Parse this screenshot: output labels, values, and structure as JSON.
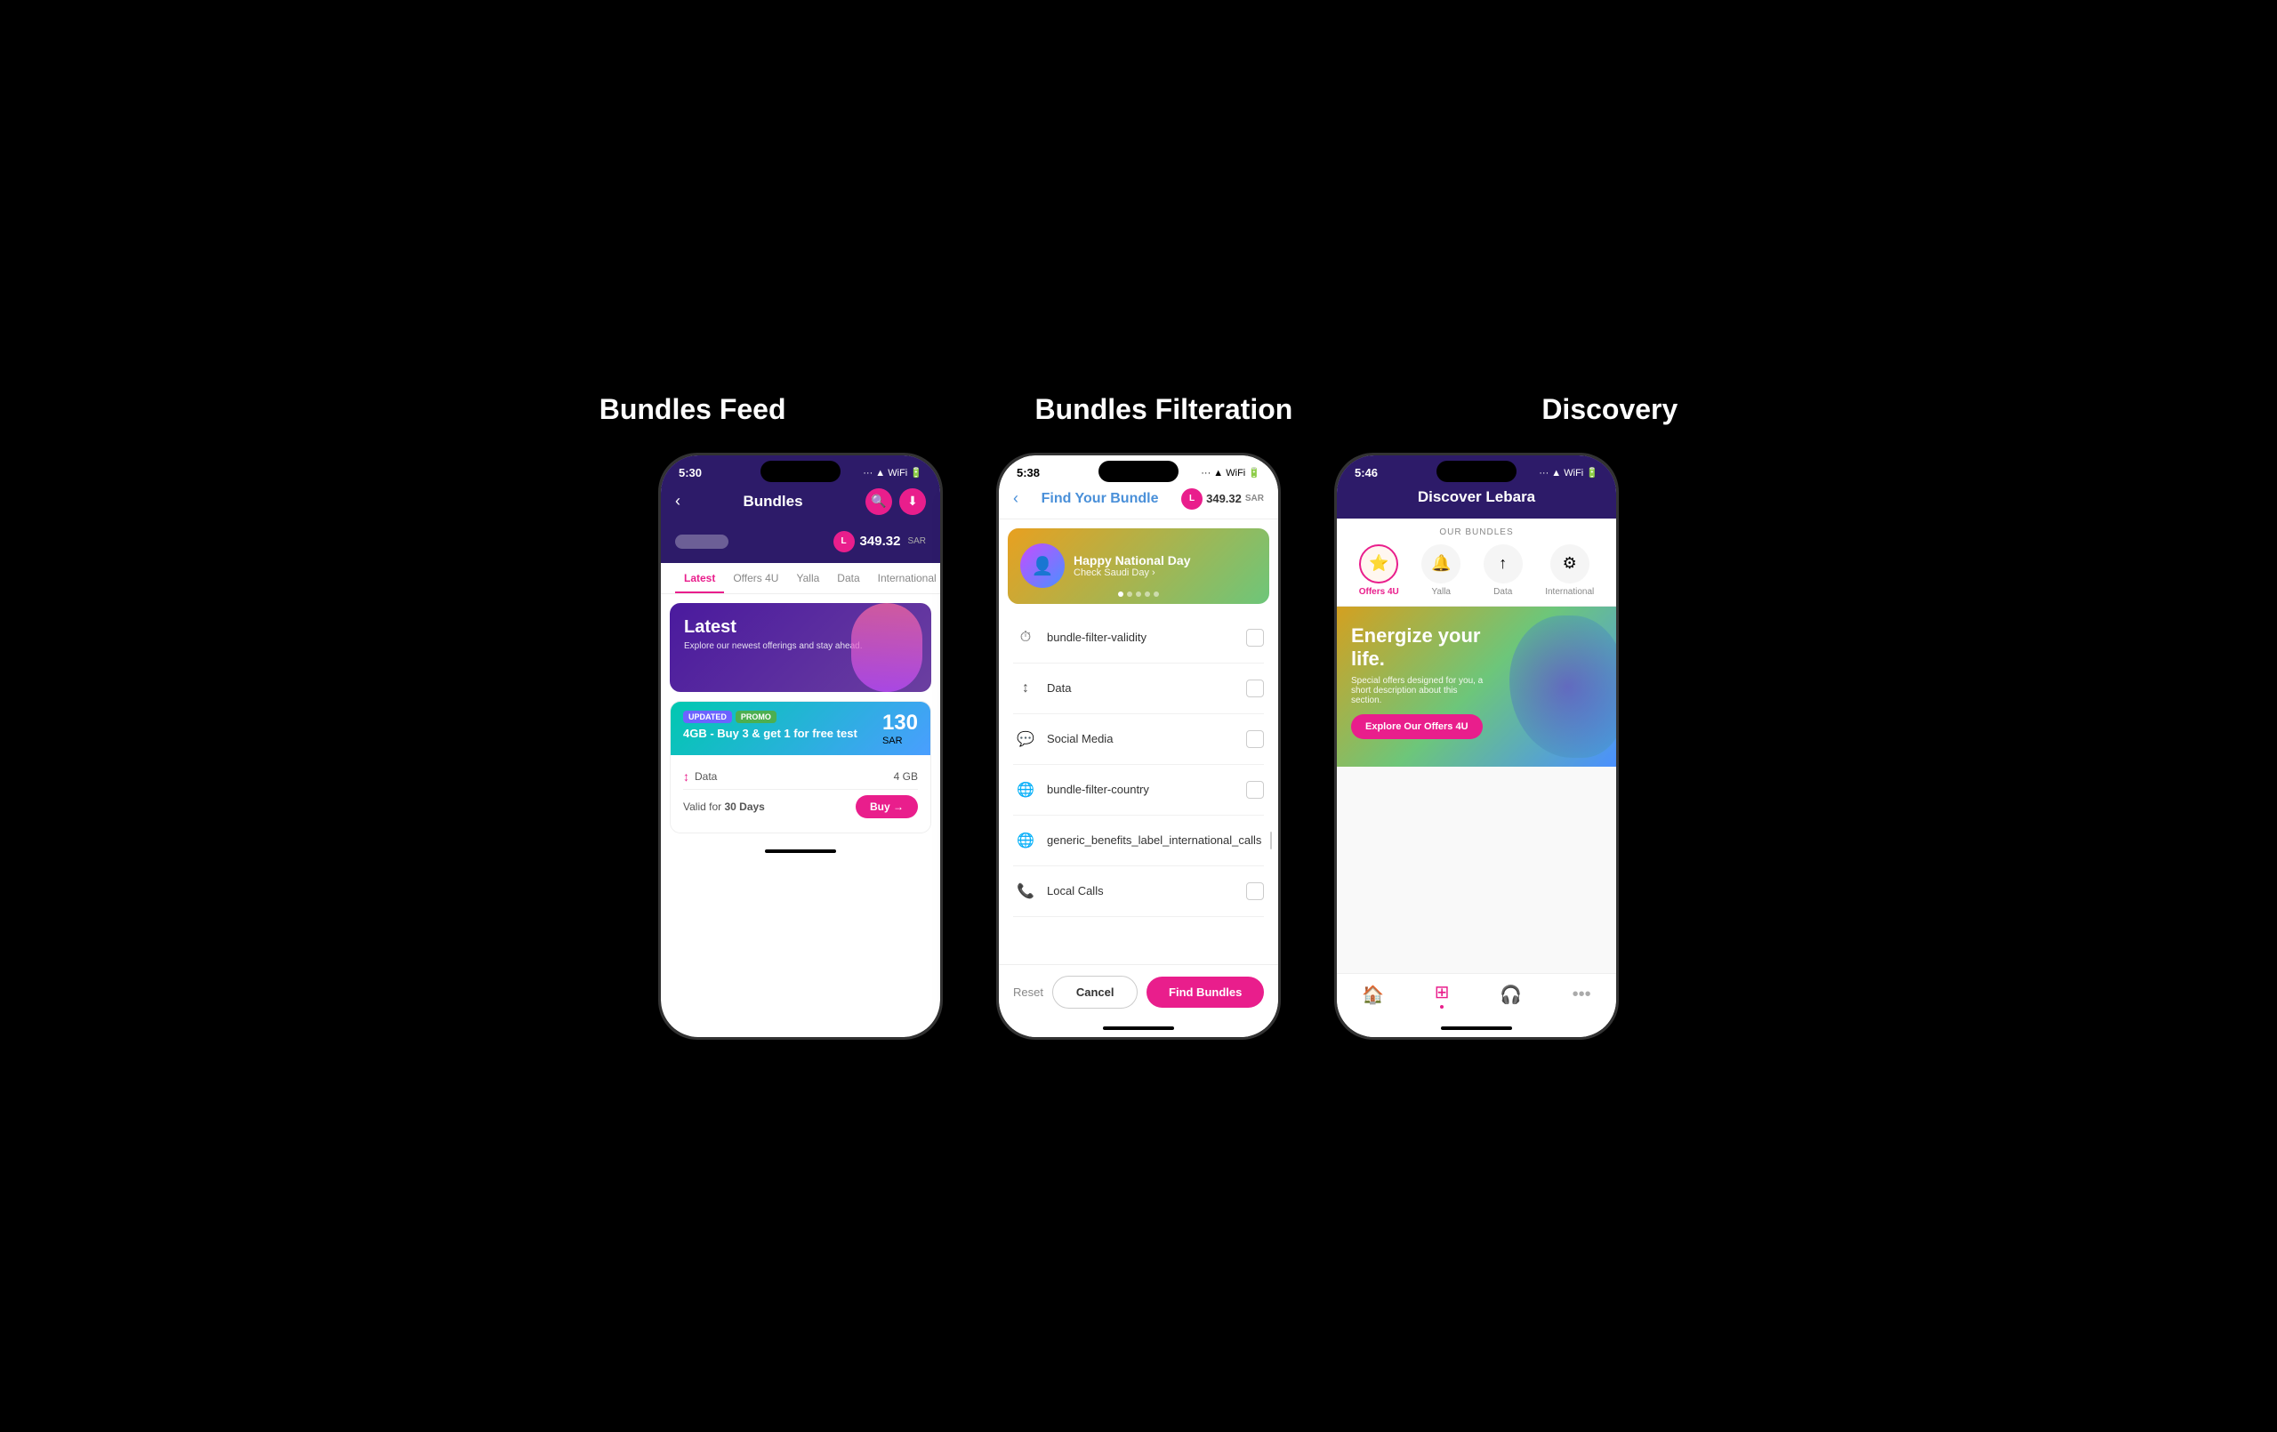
{
  "titles": {
    "bundles_feed": "Bundles Feed",
    "bundles_filteration": "Bundles Filteration",
    "discovery": "Discovery"
  },
  "phone1": {
    "status_time": "5:30",
    "header_title": "Bundles",
    "balance": "349.32",
    "balance_sar": "SAR",
    "tabs": [
      "Latest",
      "Offers 4U",
      "Yalla",
      "Data",
      "International"
    ],
    "banner_title": "Latest",
    "banner_sub": "Explore our newest offerings and stay ahead.",
    "bundle": {
      "tag_updated": "UPDATED",
      "tag_promo": "PROMO",
      "name": "4GB - Buy 3 & get 1 for free test",
      "price": "130",
      "price_sar": "SAR",
      "data_label": "Data",
      "data_value": "4 GB",
      "valid_label": "Valid for",
      "valid_days": "30 Days",
      "buy_label": "Buy →"
    }
  },
  "phone2": {
    "status_time": "5:38",
    "header_title": "Find Your Bundle",
    "balance": "349.32",
    "balance_sar": "SAR",
    "banner": {
      "title": "Happy National Day",
      "subtitle": "Check Saudi Day ›"
    },
    "filters": [
      {
        "icon": "⏱",
        "label": "bundle-filter-validity"
      },
      {
        "icon": "↕",
        "label": "Data"
      },
      {
        "icon": "💬",
        "label": "Social Media"
      },
      {
        "icon": "🌐",
        "label": "bundle-filter-country"
      },
      {
        "icon": "🌐",
        "label": "generic_benefits_label_international_calls"
      },
      {
        "icon": "📞",
        "label": "Local Calls"
      }
    ],
    "footer": {
      "reset": "Reset",
      "cancel": "Cancel",
      "find": "Find Bundles"
    }
  },
  "phone3": {
    "status_time": "5:46",
    "header_title": "Discover Lebara",
    "our_bundles_label": "OUR BUNDLES",
    "categories": [
      {
        "icon": "⭐",
        "label": "Offers 4U",
        "active": true
      },
      {
        "icon": "🔔",
        "label": "Yalla",
        "active": false
      },
      {
        "icon": "↑",
        "label": "Data",
        "active": false
      },
      {
        "icon": "⚙",
        "label": "International",
        "active": false
      }
    ],
    "banner": {
      "title": "Energize your life.",
      "subtitle": "Special offers designed for you, a short description about this section.",
      "cta": "Explore Our Offers 4U"
    },
    "nav": [
      {
        "icon": "🏠",
        "label": "home",
        "active": false
      },
      {
        "icon": "⊞",
        "label": "bundles",
        "active": true
      },
      {
        "icon": "🎧",
        "label": "support",
        "active": false
      },
      {
        "icon": "•••",
        "label": "more",
        "active": false
      }
    ]
  }
}
